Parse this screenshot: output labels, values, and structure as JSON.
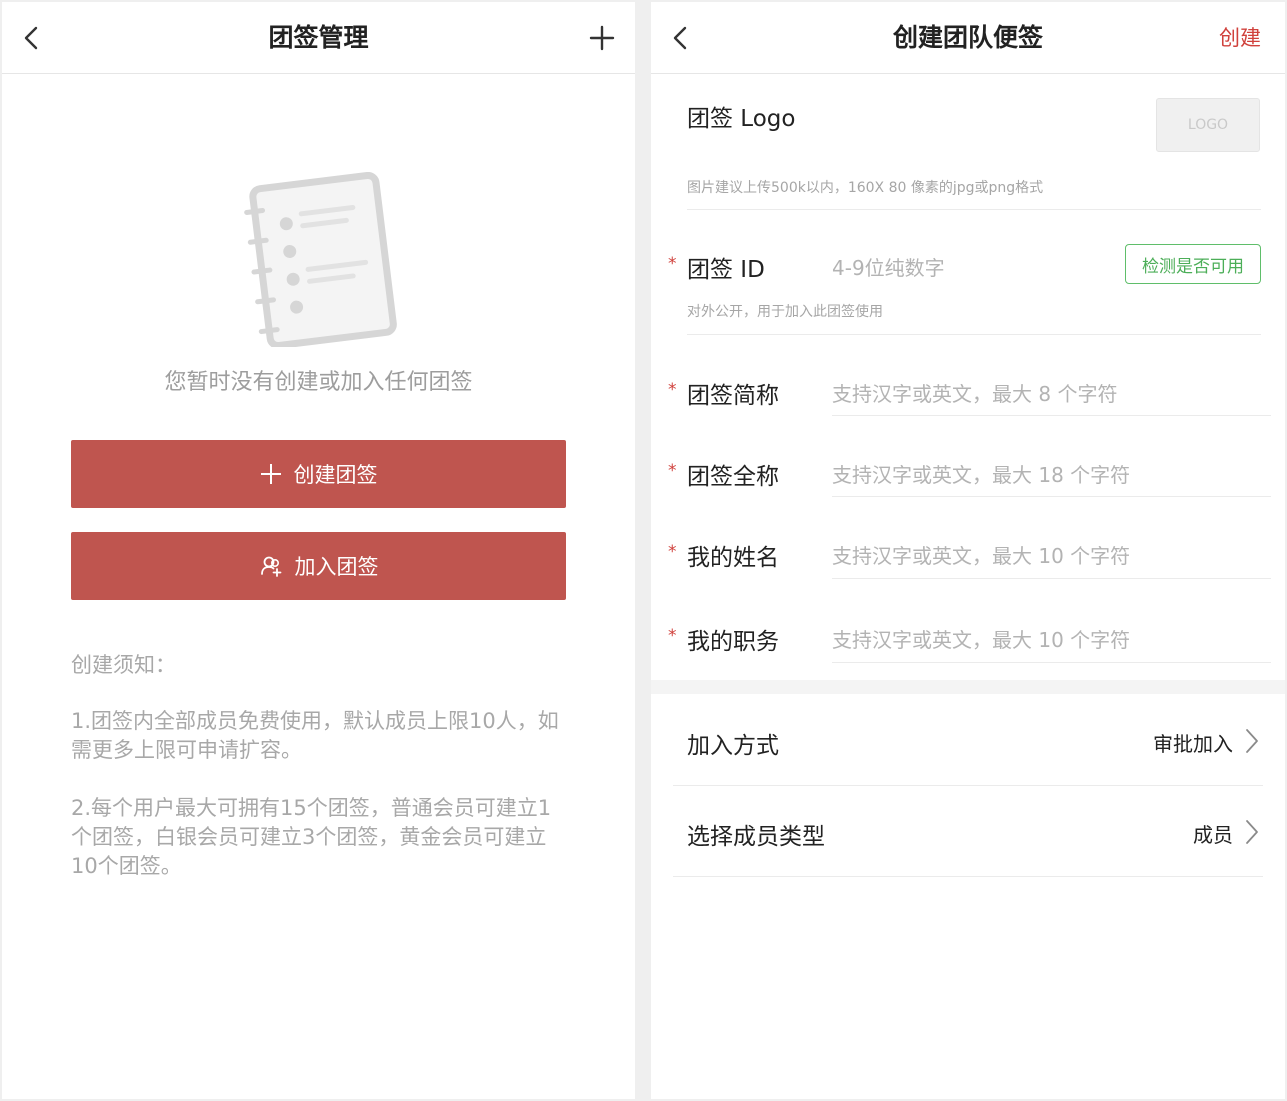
{
  "left_screen": {
    "title": "团签管理",
    "empty_text": "您暂时没有创建或加入任何团签",
    "create_button_label": "创建团签",
    "join_button_label": "加入团签",
    "notice_title": "创建须知：",
    "notice_items": [
      "1.团签内全部成员免费使用，默认成员上限10人，如需更多上限可申请扩容。",
      "2.每个用户最大可拥有15个团签，普通会员可建立1个团签，白银会员可建立3个团签，黄金会员可建立10个团签。"
    ]
  },
  "right_screen": {
    "title": "创建团队便签",
    "create_action": "创建",
    "logo_label": "团签 Logo",
    "logo_box_text": "LOGO",
    "logo_hint": "图片建议上传500k以内，160X 80 像素的jpg或png格式",
    "required_mark": "*",
    "team_id": {
      "label": "团签 ID",
      "placeholder": "4-9位纯数字",
      "check_button": "检测是否可用",
      "hint": "对外公开，用于加入此团签使用"
    },
    "short_name": {
      "label": "团签简称",
      "placeholder": "支持汉字或英文，最大 8 个字符"
    },
    "full_name": {
      "label": "团签全称",
      "placeholder": "支持汉字或英文，最大 18 个字符"
    },
    "my_name": {
      "label": "我的姓名",
      "placeholder": "支持汉字或英文，最大 10 个字符"
    },
    "my_position": {
      "label": "我的职务",
      "placeholder": "支持汉字或英文，最大 10 个字符"
    },
    "join_method": {
      "label": "加入方式",
      "value": "审批加入"
    },
    "member_type": {
      "label": "选择成员类型",
      "value": "成员"
    }
  },
  "colors": {
    "accent_red": "#bf554f",
    "create_red": "#d0413c",
    "check_green": "#4cae58"
  }
}
